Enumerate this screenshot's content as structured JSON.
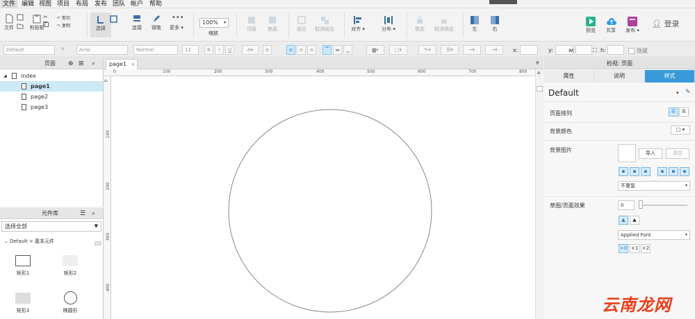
{
  "menu": [
    "文件",
    "编辑",
    "视图",
    "项目",
    "布局",
    "发布",
    "团队",
    "帐户",
    "帮助"
  ],
  "toolbar": {
    "file": "文件",
    "clipboard": "剪贴板",
    "cut": "剪切",
    "copy": "复制",
    "select": "选择",
    "connect": "连接",
    "pen": "钢笔",
    "more": "更多 ▾",
    "zoom_value": "100%",
    "zoom_label": "缩放",
    "top": "顶层",
    "bottom": "底层",
    "group": "组合",
    "ungroup": "取消组合",
    "align": "对齐 ▾",
    "distribute": "分布 ▾",
    "lock": "锁定",
    "unlock": "取消锁定",
    "left": "左",
    "right": "右",
    "preview": "预览",
    "share": "共享",
    "publish": "发布 ▾",
    "login": "登录"
  },
  "format": {
    "style": "Default",
    "font": "Arial",
    "weight": "Normal",
    "size": "13",
    "x_label": "x:",
    "y_label": "y:",
    "w_label": "w:",
    "h_label": "h:",
    "hide": "隐藏"
  },
  "pages_panel": {
    "title": "页面",
    "items": [
      "index",
      "page1",
      "page2",
      "page3"
    ]
  },
  "library": {
    "title": "元件库",
    "select_value": "选择全部",
    "group": "Default > 基本元件",
    "items": [
      "矩形1",
      "矩形2",
      "矩形3",
      "椭圆形"
    ]
  },
  "canvas": {
    "tab": "page1",
    "ruler_h": [
      "0",
      "100",
      "200",
      "300",
      "400",
      "500",
      "600",
      "700",
      "800"
    ],
    "ruler_v": [
      "0",
      "100",
      "200",
      "300",
      "400"
    ]
  },
  "inspector": {
    "title": "检视: 页面",
    "tabs": [
      "属性",
      "说明",
      "样式"
    ],
    "style_name": "Default",
    "page_align": "页面排列",
    "bg_color": "背景颜色",
    "bg_image": "背景图片",
    "import": "导入",
    "clear": "清空",
    "repeat": "不重复",
    "sketch": "草图/页面效果",
    "sketch_value": "0",
    "font": "Applied Font",
    "font_sizes": [
      "+0",
      "+1",
      "+2"
    ]
  },
  "watermark": "云南龙网",
  "colors": {
    "accent": "#3a9ad9",
    "watermark": "#e8401c"
  }
}
